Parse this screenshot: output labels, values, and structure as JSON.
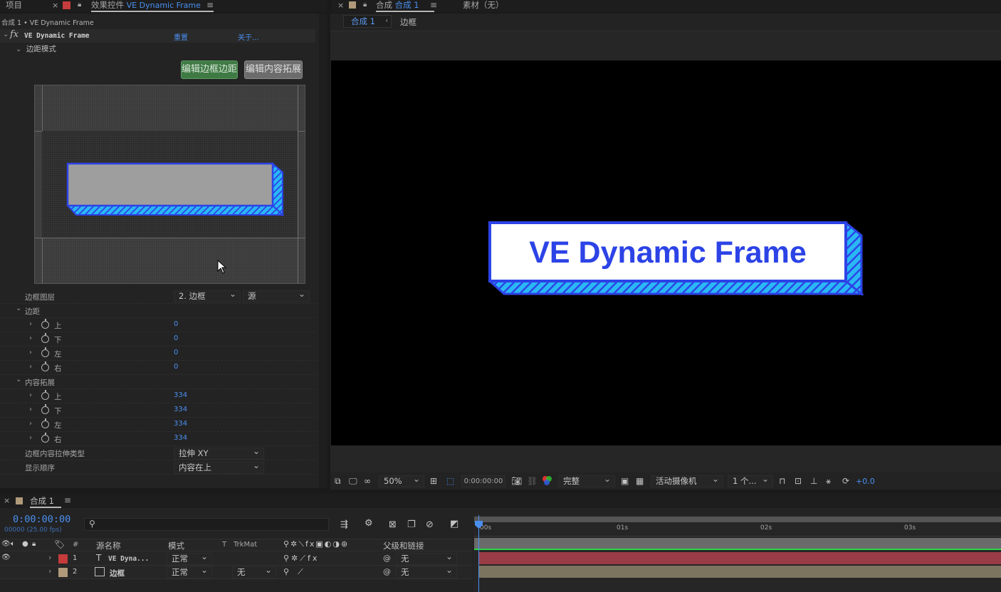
{
  "top_tabs": {
    "project": "项目",
    "effects_prefix": "效果控件",
    "effects_layer": "VE Dynamic Frame",
    "comp_prefix": "合成",
    "comp_name": "合成 1",
    "footage": "素材（无）"
  },
  "effects": {
    "breadcrumb": "合成 1 • VE Dynamic Frame",
    "effect_name": "VE Dynamic Frame",
    "reset": "重置",
    "about": "关于...",
    "margin_mode": "边距模式",
    "btn_edit_margin": "编辑边框边距",
    "btn_edit_content": "编辑内容拓展",
    "props": {
      "frame_layer": "边框图层",
      "frame_layer_value": "2. 边框",
      "frame_layer_source": "源",
      "margin": "边距",
      "content_ext": "内容拓展",
      "top": "上",
      "bottom": "下",
      "left": "左",
      "right": "右",
      "margin_top": "0",
      "margin_bottom": "0",
      "margin_left": "0",
      "margin_right": "0",
      "ext_top": "334",
      "ext_bottom": "334",
      "ext_left": "334",
      "ext_right": "334",
      "stretch_type": "边框内容拉伸类型",
      "stretch_value": "拉伸 XY",
      "display_order": "显示顺序",
      "display_value": "内容在上"
    }
  },
  "composition": {
    "breadcrumb_comp": "合成 1",
    "breadcrumb_layer": "边框",
    "frame_text": "VE Dynamic Frame",
    "toolbar": {
      "zoom": "50%",
      "timecode": "0:00:00:00",
      "resolution": "完整",
      "camera": "活动摄像机",
      "views": "1 个...",
      "exposure": "+0.0"
    }
  },
  "timeline": {
    "comp_tab": "合成 1",
    "timecode": "0:00:00:00",
    "frames_fps": "00000 (25.00 fps)",
    "columns": {
      "num": "#",
      "source_name": "源名称",
      "mode": "模式",
      "t": "T",
      "trkmat": "TrkMat",
      "parent": "父级和链接"
    },
    "ruler": [
      "00s",
      "01s",
      "02s",
      "03s"
    ],
    "layers": [
      {
        "num": "1",
        "name": "VE Dyna...",
        "mode": "正常",
        "trkmat": "",
        "parent": "无",
        "label_color": "#c63b3b"
      },
      {
        "num": "2",
        "name": "边框",
        "mode": "正常",
        "trkmat": "无",
        "parent": "无",
        "label_color": "#b09a7a"
      }
    ]
  },
  "colors": {
    "accent_blue": "#2c43e6",
    "stripe_cyan": "#2ab8f5",
    "layer1_bar": "#9a3c46",
    "layer2_bar": "#7d7460",
    "link_blue": "#4a8ff0",
    "button_green": "#3f7a45"
  }
}
